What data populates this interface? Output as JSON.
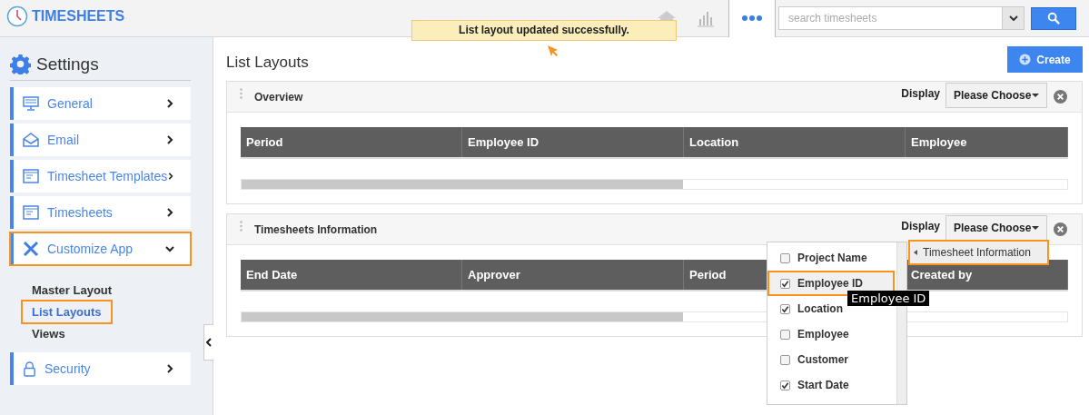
{
  "app": {
    "title": "TIMESHEETS"
  },
  "header": {
    "nav_icons": [
      {
        "kind": "home",
        "selected": false
      },
      {
        "kind": "chart",
        "selected": false
      },
      {
        "kind": "more",
        "selected": true
      }
    ],
    "search": {
      "placeholder": "search timesheets"
    }
  },
  "toast": {
    "message": "List layout updated successfully."
  },
  "sidebar": {
    "title": "Settings",
    "items": [
      {
        "label": "General",
        "kind": "monitor",
        "expanded": false,
        "highlighted": false
      },
      {
        "label": "Email",
        "kind": "envelope",
        "expanded": false,
        "highlighted": false
      },
      {
        "label": "Timesheet Templates",
        "kind": "window",
        "expanded": false,
        "highlighted": false
      },
      {
        "label": "Timesheets",
        "kind": "window",
        "expanded": false,
        "highlighted": false
      },
      {
        "label": "Customize App",
        "kind": "tools",
        "expanded": true,
        "highlighted": true,
        "children": [
          {
            "label": "Master Layout",
            "selected": false,
            "highlighted": false
          },
          {
            "label": "List Layouts",
            "selected": true,
            "highlighted": true
          },
          {
            "label": "Views",
            "selected": false,
            "highlighted": false
          }
        ]
      },
      {
        "label": "Security",
        "kind": "lock",
        "expanded": false,
        "highlighted": false
      }
    ]
  },
  "page": {
    "title": "List Layouts",
    "create_button": "Create"
  },
  "panels": [
    {
      "title": "Overview",
      "display_label": "Display",
      "dropdown": "Please Choose",
      "columns": [
        "Period",
        "Employee ID",
        "Location",
        "Employee"
      ]
    },
    {
      "title": "Timesheets Information",
      "display_label": "Display",
      "dropdown": "Please Choose",
      "columns": [
        "End Date",
        "Approver",
        "Period",
        "Created by"
      ],
      "column_menu": {
        "items": [
          {
            "label": "Project Name",
            "checked": false,
            "highlighted": false
          },
          {
            "label": "Employee ID",
            "checked": true,
            "highlighted": true
          },
          {
            "label": "Location",
            "checked": true,
            "highlighted": false
          },
          {
            "label": "Employee",
            "checked": false,
            "highlighted": false
          },
          {
            "label": "Customer",
            "checked": false,
            "highlighted": false
          },
          {
            "label": "Start Date",
            "checked": true,
            "highlighted": false
          }
        ],
        "tooltip": "Employee ID"
      },
      "submenu": {
        "label": "Timesheet Information",
        "highlighted": true
      }
    }
  ]
}
